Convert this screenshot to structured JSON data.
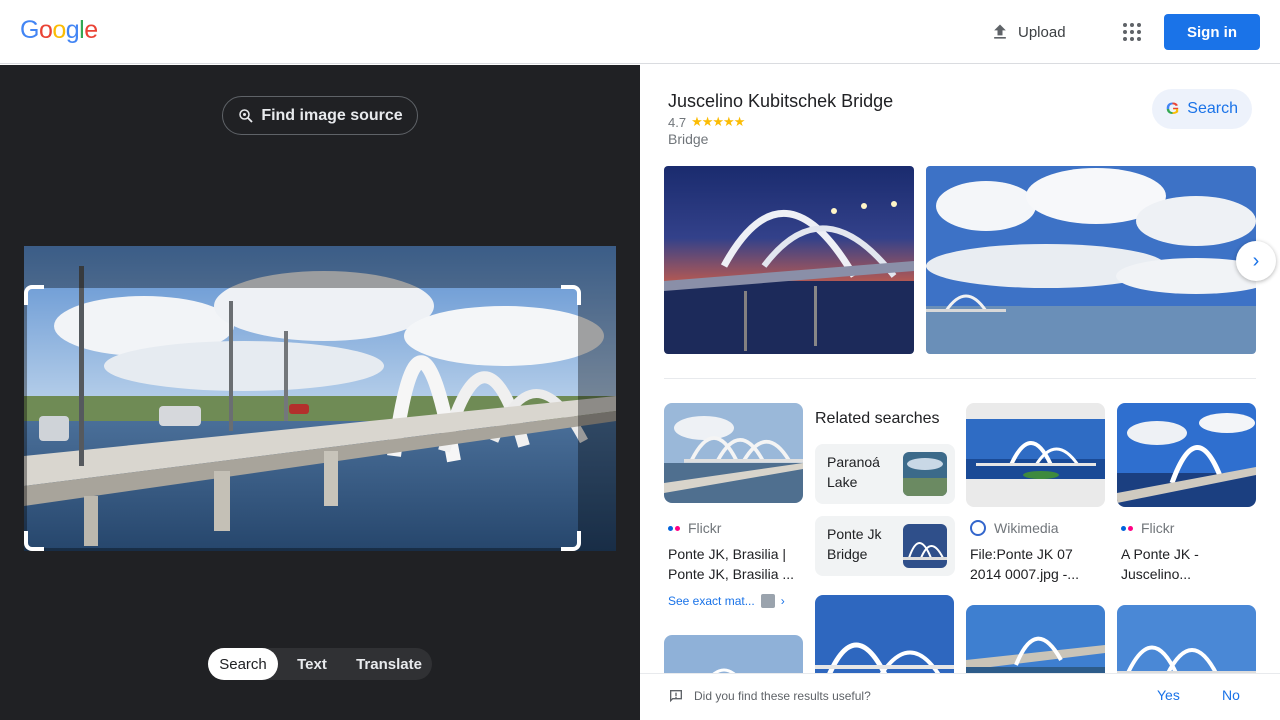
{
  "header": {
    "logo_letters": [
      {
        "ch": "G",
        "color": "#4285f4"
      },
      {
        "ch": "o",
        "color": "#ea4335"
      },
      {
        "ch": "o",
        "color": "#fbbc04"
      },
      {
        "ch": "g",
        "color": "#4285f4"
      },
      {
        "ch": "l",
        "color": "#34a853"
      },
      {
        "ch": "e",
        "color": "#ea4335"
      }
    ],
    "upload_label": "Upload",
    "apps_icon": "apps-grid-icon",
    "signin_label": "Sign in"
  },
  "left": {
    "find_source_label": "Find image source",
    "modes": [
      "Search",
      "Text",
      "Translate"
    ],
    "active_mode": "Search"
  },
  "entity": {
    "title": "Juscelino Kubitschek Bridge",
    "rating": "4.7",
    "stars": "★★★★★",
    "type": "Bridge",
    "search_label": "Search"
  },
  "results": [
    {
      "source": "Flickr",
      "title": "Ponte JK, Brasilia | Ponte JK, Brasilia ..."
    },
    {
      "source": "Wikimedia",
      "title": "File:Ponte JK 07 2014 0007.jpg -..."
    },
    {
      "source": "Flickr",
      "title": "A Ponte JK - Juscelino..."
    }
  ],
  "exact_matches_label": "See exact mat...",
  "related": {
    "title": "Related searches",
    "items": [
      "Paranoá Lake",
      "Ponte Jk Bridge"
    ]
  },
  "feedback": {
    "question": "Did you find these results useful?",
    "yes": "Yes",
    "no": "No"
  },
  "colors": {
    "accent": "#1a73e8",
    "dark_panel": "#202124",
    "star": "#fbbc04"
  }
}
